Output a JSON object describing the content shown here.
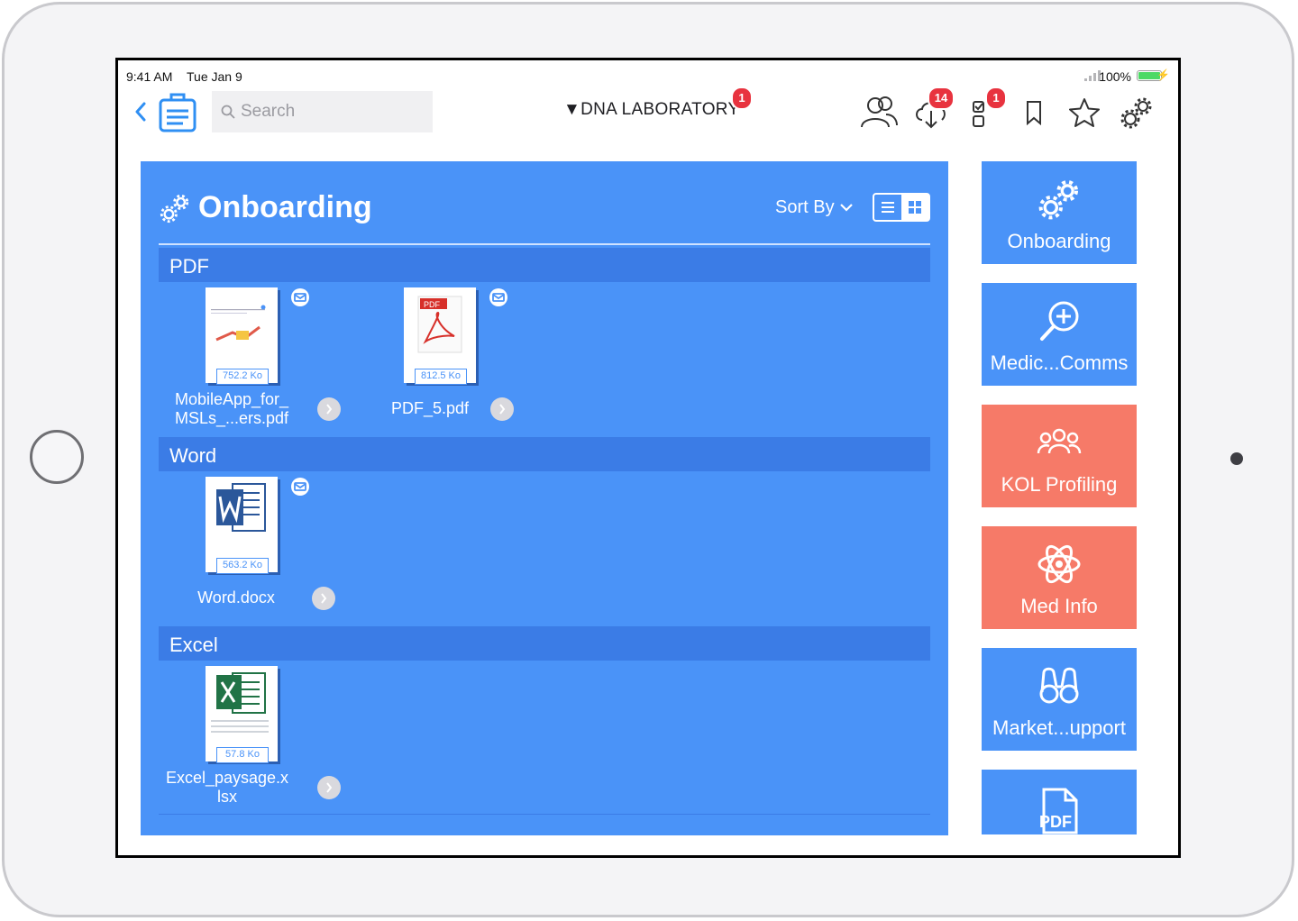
{
  "status_bar": {
    "time": "9:41 AM",
    "date": "Tue Jan 9",
    "battery": "100%"
  },
  "nav": {
    "search_placeholder": "Search",
    "library": "▼DNA LABORATORY",
    "library_badge": "1",
    "downloads_badge": "14",
    "tasks_badge": "1"
  },
  "panel": {
    "title": "Onboarding",
    "sort_label": "Sort By",
    "sections": {
      "pdf": "PDF",
      "word": "Word",
      "excel": "Excel"
    },
    "files": [
      {
        "name_line1": "MobileApp_for_",
        "name_line2": "MSLs_...ers.pdf",
        "size": "752.2 Ko"
      },
      {
        "name_line1": "PDF_5.pdf",
        "size": "812.5 Ko",
        "thumb_label": "PDF"
      },
      {
        "name_line1": "Word.docx",
        "size": "563.2 Ko"
      },
      {
        "name_line1": "Excel_paysage.x",
        "name_line2": "lsx",
        "size": "57.8 Ko"
      }
    ]
  },
  "tiles": [
    {
      "label": "Onboarding",
      "icon": "gears-icon",
      "color": "#4a93f8"
    },
    {
      "label": "Medic...Comms",
      "icon": "zoom-in-icon",
      "color": "#4a93f8"
    },
    {
      "label": "KOL Profiling",
      "icon": "people-icon",
      "color": "#f67a68"
    },
    {
      "label": "Med Info",
      "icon": "atom-icon",
      "color": "#f67a68"
    },
    {
      "label": "Market...upport",
      "icon": "binoculars-icon",
      "color": "#4a93f8"
    },
    {
      "label": "PDF",
      "icon": "pdf-file-icon",
      "color": "#4a93f8"
    }
  ],
  "colors": {
    "accent_blue": "#4a93f8",
    "section_blue": "#3b7ce6",
    "salmon": "#f67a68",
    "badge_red": "#e8333f"
  }
}
